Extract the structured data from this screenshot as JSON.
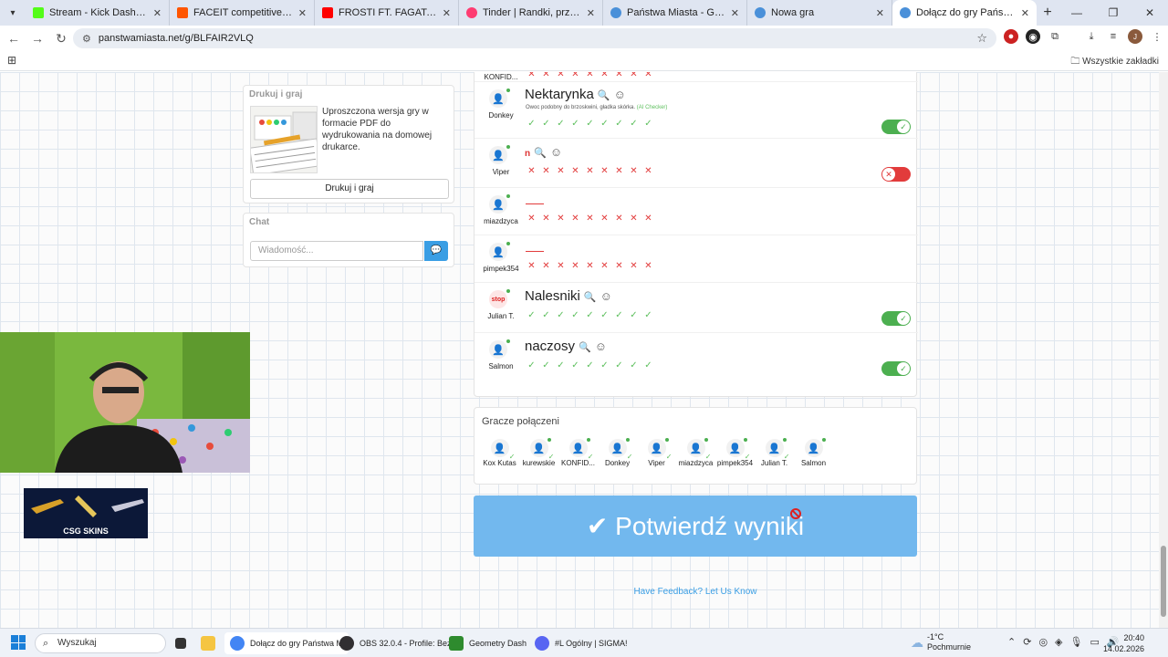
{
  "browser": {
    "tabs": [
      {
        "label": "Stream - Kick Dashboard",
        "color": "#53fc18"
      },
      {
        "label": "FACEIT competitive match - FACE",
        "color": "#ff5500"
      },
      {
        "label": "FROSTI FT. FAGATA - TOXIC - YouT",
        "color": "#ff0000"
      },
      {
        "label": "Tinder | Randki, przyjaźń, nowe",
        "color": "#fe3c72"
      },
      {
        "label": "Państwa Miasta - Gra online",
        "color": "#4a90d9"
      },
      {
        "label": "Nowa gra",
        "color": "#4a90d9"
      },
      {
        "label": "Dołącz do gry Państwa Miasta",
        "color": "#4a90d9"
      }
    ],
    "url": "panstwamiasta.net/g/BLFAIR2VLQ",
    "all_bookmarks": "Wszystkie zakładki"
  },
  "print_card": {
    "title": "Drukuj i graj",
    "description": "Uproszczona wersja gry w formacie PDF do wydrukowania na domowej drukarce.",
    "button": "Drukuj i graj"
  },
  "chat": {
    "title": "Chat",
    "placeholder": "Wiadomość..."
  },
  "answers": {
    "konfid_label": "KONFID...",
    "rows": [
      {
        "player": "Donkey",
        "word": "Nektarynka",
        "description": "Owoc podobny do brzoskwini, gładka skórka.",
        "checker": "(AI Checker)",
        "status": "ok",
        "toggle": "on"
      },
      {
        "player": "Viper",
        "word": "n",
        "status": "x",
        "toggle": "off"
      },
      {
        "player": "miazdzyca",
        "word": "",
        "status": "x",
        "toggle": "none"
      },
      {
        "player": "pimpek354",
        "word": "",
        "status": "x",
        "toggle": "none"
      },
      {
        "player": "Julian T.",
        "word": "Nalesniki",
        "status": "ok",
        "toggle": "on"
      },
      {
        "player": "Salmon",
        "word": "naczosy",
        "status": "ok",
        "toggle": "on"
      }
    ]
  },
  "connected": {
    "title": "Gracze połączeni",
    "players": [
      "Kox Kutas",
      "kurewskie",
      "KONFID...",
      "Donkey",
      "Viper",
      "miazdzyca",
      "pimpek354",
      "Julian T.",
      "Salmon"
    ]
  },
  "confirm_button": "Potwierdź wyniki",
  "feedback_link": "Have Feedback? Let Us Know",
  "sponsor": "CSG SKINS",
  "taskbar": {
    "search": "Wyszukaj",
    "items": [
      {
        "label": "Dołącz do gry Państwa M",
        "color": "#4285f4"
      },
      {
        "label": "OBS 32.0.4 - Profile: Bez",
        "color": "#302e31"
      },
      {
        "label": "Geometry Dash",
        "color": "#2e8b2e"
      },
      {
        "label": "#L  Ogólny | SIGMA!",
        "color": "#5865f2"
      }
    ],
    "weather_temp": "-1°C",
    "weather_desc": "Pochmurnie",
    "time": "20:40",
    "date": "14.02.2026"
  }
}
